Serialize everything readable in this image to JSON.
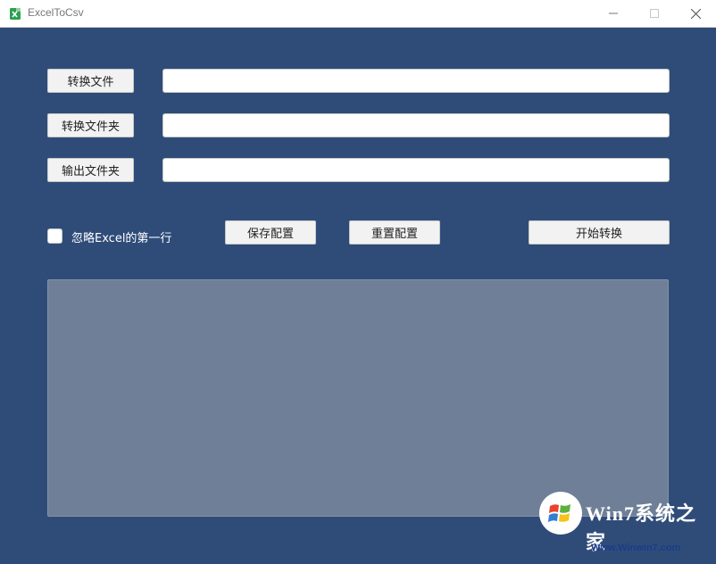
{
  "window": {
    "title": "ExcelToCsv"
  },
  "form": {
    "convert_file_label": "转换文件",
    "convert_folder_label": "转换文件夹",
    "output_folder_label": "输出文件夹",
    "convert_file_value": "",
    "convert_folder_value": "",
    "output_folder_value": ""
  },
  "options": {
    "skip_first_row_label": "忽略Excel的第一行",
    "skip_first_row_checked": false
  },
  "actions": {
    "save_config_label": "保存配置",
    "reset_config_label": "重置配置",
    "start_convert_label": "开始转换"
  },
  "log": {
    "content": ""
  },
  "watermark": {
    "brand_text": "Win7系统之家",
    "url": "Www.Winwin7.com"
  },
  "colors": {
    "background": "#2f4c79",
    "log_area": "#6e7f97",
    "titlebar": "#ffffff",
    "app_icon": "#2e9e4f"
  },
  "icons": {
    "app": "excel-icon",
    "minimize": "minimize-icon",
    "maximize": "maximize-icon",
    "close": "close-icon",
    "watermark_logo": "windows-logo-icon"
  }
}
